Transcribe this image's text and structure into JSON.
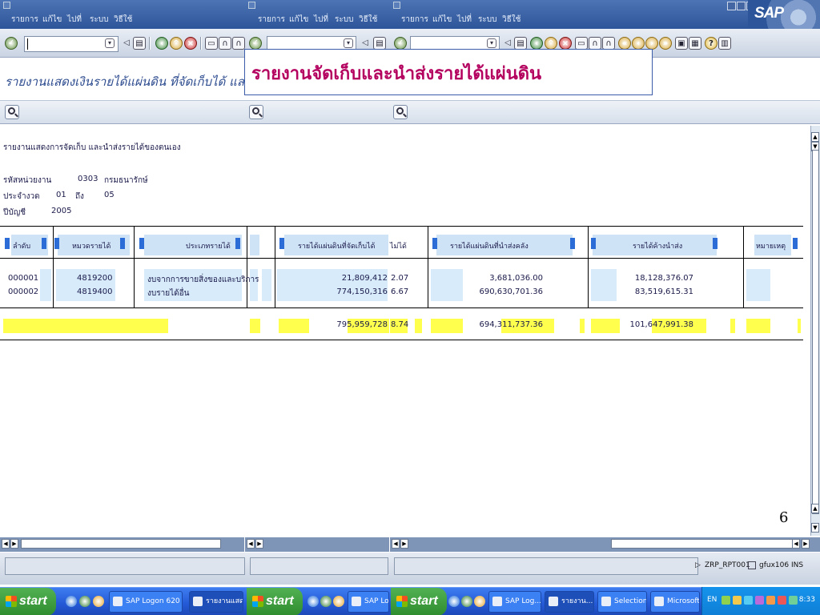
{
  "menu": {
    "panes": [
      [
        "รายการ",
        "แก้ไข",
        "ไปที่",
        "ระบบ",
        "วิธีใช้"
      ],
      [
        "รายการ",
        "แก้ไข",
        "ไปที่",
        "ระบบ",
        "วิธีใช้"
      ],
      [
        "รายการ",
        "แก้ไข",
        "ไปที่",
        "ระบบ",
        "วิธีใช้"
      ]
    ],
    "logo": "SAP"
  },
  "title": {
    "text": "รายงานแสดงเงินรายได้แผ่นดิน ที่จัดเก็บได้ และนำส่ง",
    "banner": "รายงานจัดเก็บและนำส่งรายได้แผ่นดิน"
  },
  "report": {
    "heading": "รายงานแสดงการจัดเก็บ และนำส่งรายได้ของตนเอง",
    "agency_label": "รหัสหน่วยงาน",
    "agency_code": "0303",
    "agency_name": "กรมธนารักษ์",
    "period_label": "ประจำงวด",
    "period_from": "01",
    "period_to_word": "ถึง",
    "period_to": "05",
    "year_label": "ปีบัญชี",
    "year": "2005",
    "columns": {
      "seq": "ลำดับ",
      "code": "หมวดรายได้",
      "type": "ประเภทรายได้",
      "collected": "รายได้แผ่นดินที่จัดเก็บได้",
      "pct1": "ไม่ได้",
      "remitted": "รายได้แผ่นดินที่นำส่งคลัง",
      "pending": "รายได้ค้างนำส่ง",
      "note": "หมายเหตุ"
    },
    "rows": [
      {
        "seq": "000001",
        "code": "4819200",
        "type": "งบจากการขายสิ่งของและบริการ",
        "collected": "21,809,412",
        "pct": "2.07",
        "remitted": "3,681,036.00",
        "pending": "18,128,376.07"
      },
      {
        "seq": "000002",
        "code": "4819400",
        "type": "งบรายได้อื่น",
        "collected": "774,150,316",
        "pct": "6.67",
        "remitted": "690,630,701.36",
        "pending": "83,519,615.31"
      }
    ],
    "totals": {
      "collected": "795,959,728",
      "pct": "8.74",
      "remitted": "694,311,737.36",
      "pending": "101,647,991.38"
    }
  },
  "page_number": "6",
  "status": {
    "program": "ZRP_RPT001",
    "server": "gfux106",
    "mode": "INS"
  },
  "taskbar": {
    "start": "start",
    "tasks": [
      "SAP Logon 620",
      "รายงานแสดงเ",
      "SAP Log...",
      "SAP Log...",
      "รายงาน...",
      "Selection...",
      "Microsoft..."
    ],
    "lang": "EN",
    "clock": "8:33"
  },
  "colors": {
    "accent": "#2d5599",
    "banner_text": "#b4005f",
    "header_cell": "#cfe3f7",
    "total_cell": "#ffff4d"
  }
}
